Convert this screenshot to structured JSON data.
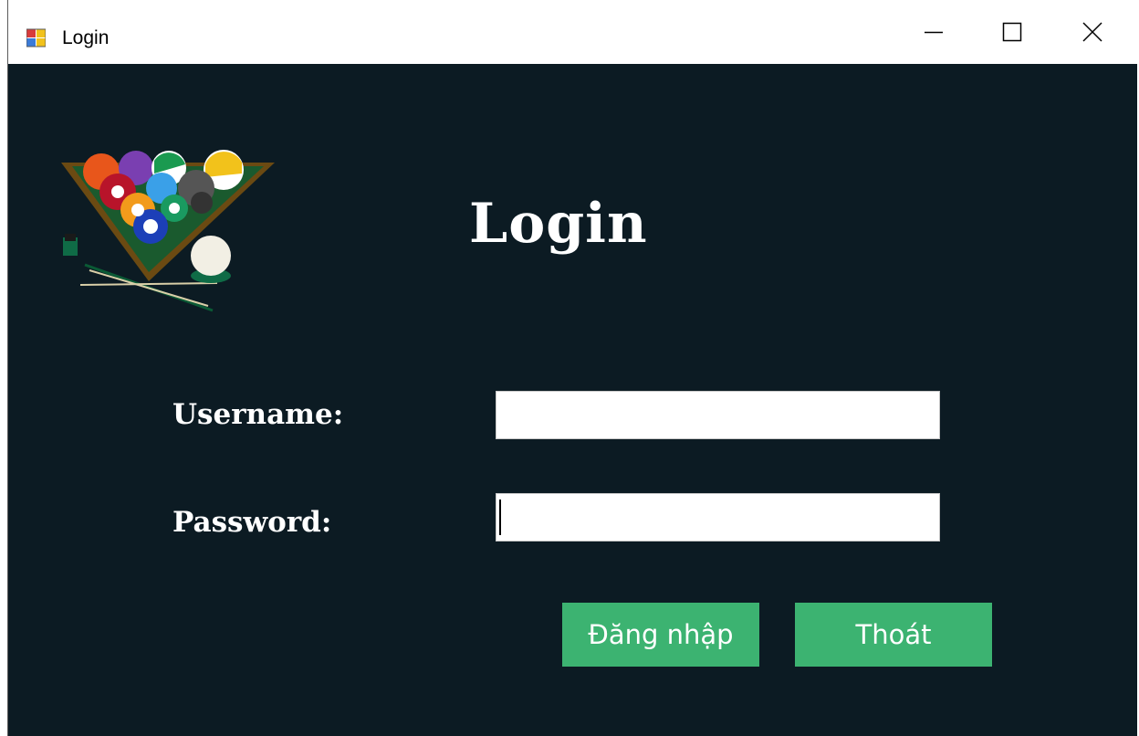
{
  "window": {
    "title": "Login",
    "icon": "app-window-icon",
    "controls": {
      "minimize": "minimize-icon",
      "maximize": "maximize-icon",
      "close": "close-icon"
    }
  },
  "form": {
    "heading": "Login",
    "logo": "billiard-balls-rack-logo",
    "username_label": "Username:",
    "username_value": "",
    "password_label": "Password:",
    "password_value": "",
    "login_button": "Đăng nhập",
    "exit_button": "Thoát"
  },
  "colors": {
    "background": "#0c1b23",
    "button": "#3cb371",
    "text": "#ffffff"
  }
}
